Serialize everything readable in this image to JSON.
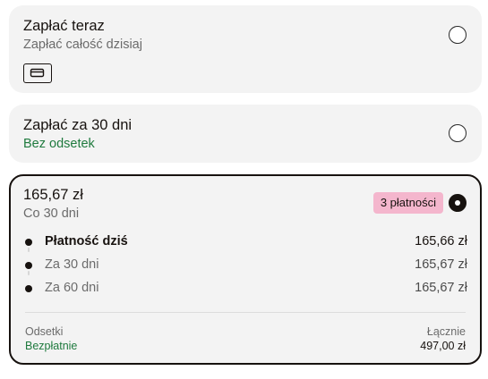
{
  "options": {
    "pay_now": {
      "title": "Zapłać teraz",
      "subtitle": "Zapłać całość dzisiaj",
      "icon": "credit-card-icon",
      "selected": false
    },
    "pay_30": {
      "title": "Zapłać za 30 dni",
      "subtitle": "Bez odsetek",
      "selected": false
    },
    "pay_split": {
      "amount": "165,67 zł",
      "frequency": "Co 30 dni",
      "badge": "3 płatności",
      "selected": true,
      "schedule": [
        {
          "label": "Płatność dziś",
          "amount": "165,66 zł"
        },
        {
          "label": "Za 30 dni",
          "amount": "165,67 zł"
        },
        {
          "label": "Za 60 dni",
          "amount": "165,67 zł"
        }
      ],
      "interest_label": "Odsetki",
      "interest_value": "Bezpłatnie",
      "total_label": "Łącznie",
      "total_value": "497,00 zł"
    }
  },
  "colors": {
    "card_bg": "#f3f3f3",
    "text": "#17120f",
    "muted": "#6b6b6b",
    "green": "#1f7a3e",
    "badge_bg": "#f4b6cd"
  }
}
